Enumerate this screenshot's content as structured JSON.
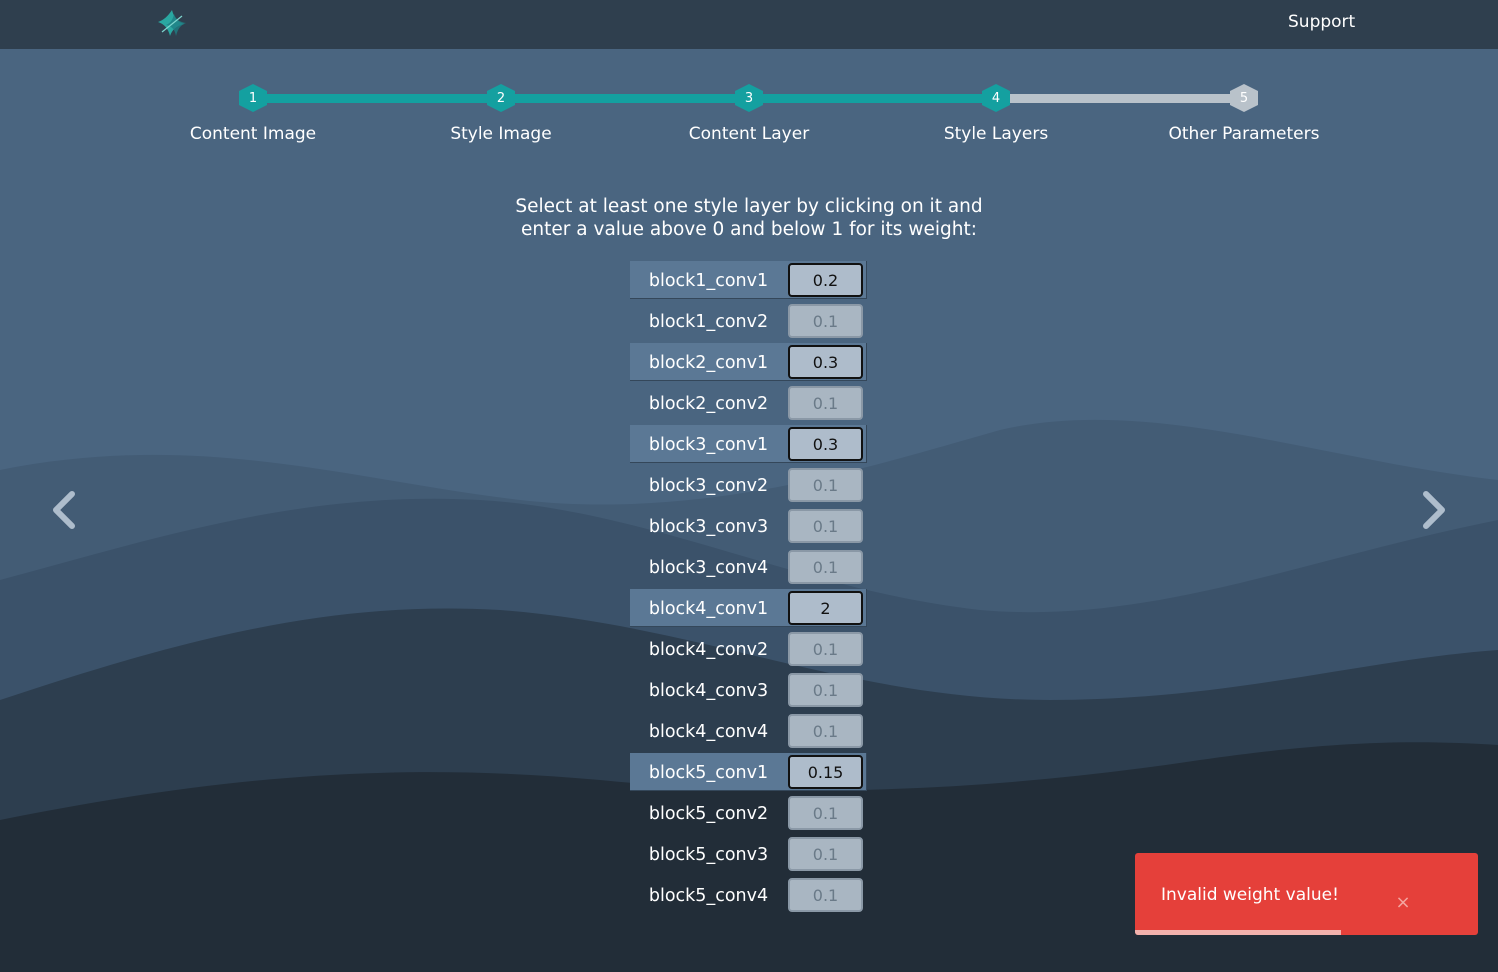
{
  "header": {
    "support_label": "Support",
    "logo_icon": "leaf-logo-icon"
  },
  "stepper": {
    "steps": [
      {
        "number": "1",
        "label": "Content Image",
        "status": "done"
      },
      {
        "number": "2",
        "label": "Style Image",
        "status": "done"
      },
      {
        "number": "3",
        "label": "Content Layer",
        "status": "done"
      },
      {
        "number": "4",
        "label": "Style Layers",
        "status": "current"
      },
      {
        "number": "5",
        "label": "Other Parameters",
        "status": "todo"
      }
    ],
    "accent_color": "#14a0a0",
    "pending_color": "#b9c2ca"
  },
  "instructions": {
    "line1": "Select at least one style layer by clicking on it and",
    "line2": "enter a value above 0 and below 1 for its weight:"
  },
  "layers": [
    {
      "name": "block1_conv1",
      "weight": "0.2",
      "selected": true
    },
    {
      "name": "block1_conv2",
      "weight": "0.1",
      "selected": false
    },
    {
      "name": "block2_conv1",
      "weight": "0.3",
      "selected": true
    },
    {
      "name": "block2_conv2",
      "weight": "0.1",
      "selected": false
    },
    {
      "name": "block3_conv1",
      "weight": "0.3",
      "selected": true
    },
    {
      "name": "block3_conv2",
      "weight": "0.1",
      "selected": false
    },
    {
      "name": "block3_conv3",
      "weight": "0.1",
      "selected": false
    },
    {
      "name": "block3_conv4",
      "weight": "0.1",
      "selected": false
    },
    {
      "name": "block4_conv1",
      "weight": "2",
      "selected": true
    },
    {
      "name": "block4_conv2",
      "weight": "0.1",
      "selected": false
    },
    {
      "name": "block4_conv3",
      "weight": "0.1",
      "selected": false
    },
    {
      "name": "block4_conv4",
      "weight": "0.1",
      "selected": false
    },
    {
      "name": "block5_conv1",
      "weight": "0.15",
      "selected": true
    },
    {
      "name": "block5_conv2",
      "weight": "0.1",
      "selected": false
    },
    {
      "name": "block5_conv3",
      "weight": "0.1",
      "selected": false
    },
    {
      "name": "block5_conv4",
      "weight": "0.1",
      "selected": false
    }
  ],
  "navigation": {
    "prev_icon": "chevron-left-icon",
    "next_icon": "chevron-right-icon"
  },
  "toast": {
    "message": "Invalid weight value!",
    "close_glyph": "×",
    "color": "#e5403a",
    "progress_fraction": 0.6
  }
}
